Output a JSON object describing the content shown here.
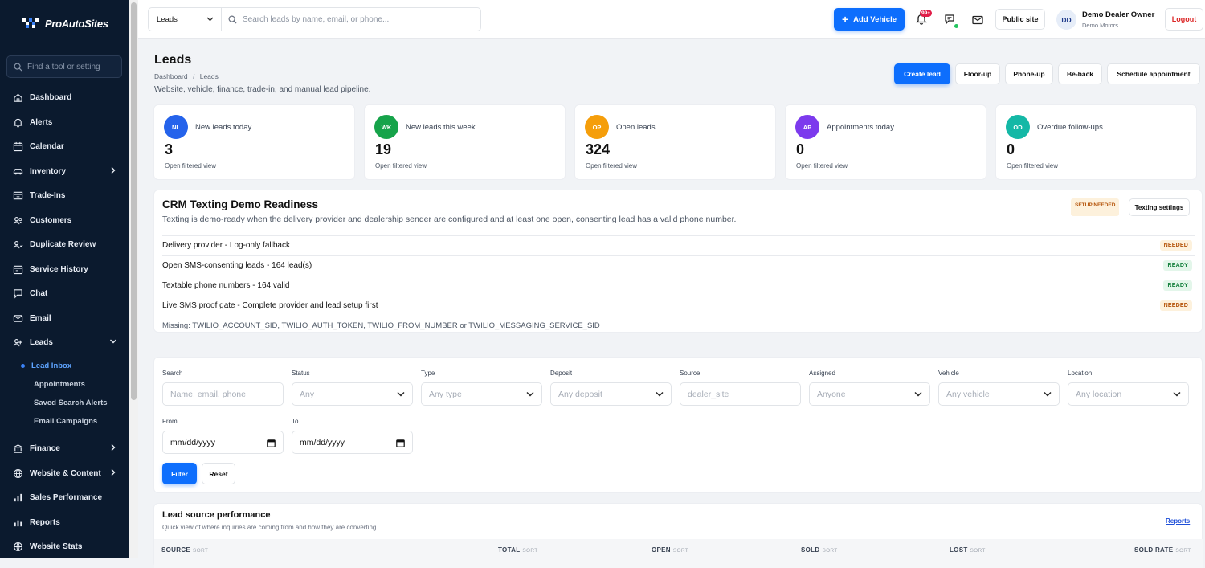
{
  "app": {
    "logo_text": "ProAutoSites"
  },
  "sidebar": {
    "search_placeholder": "Find a tool or setting",
    "items": [
      {
        "label": "Dashboard",
        "icon": "home-icon"
      },
      {
        "label": "Alerts",
        "icon": "bell-icon"
      },
      {
        "label": "Calendar",
        "icon": "calendar-icon"
      },
      {
        "label": "Inventory",
        "icon": "car-icon",
        "chevron": "right"
      },
      {
        "label": "Trade-Ins",
        "icon": "trade-icon"
      },
      {
        "label": "Customers",
        "icon": "users-icon"
      },
      {
        "label": "Duplicate Review",
        "icon": "duplicate-icon"
      },
      {
        "label": "Service History",
        "icon": "history-icon"
      },
      {
        "label": "Chat",
        "icon": "chat-icon"
      },
      {
        "label": "Email",
        "icon": "mail-icon"
      },
      {
        "label": "Leads",
        "icon": "leads-icon",
        "chevron": "down"
      }
    ],
    "sub_items": [
      {
        "label": "Lead Inbox",
        "active": true
      },
      {
        "label": "Appointments"
      },
      {
        "label": "Saved Search Alerts"
      },
      {
        "label": "Email Campaigns"
      }
    ],
    "items_after": [
      {
        "label": "Finance",
        "icon": "finance-icon",
        "chevron": "right"
      },
      {
        "label": "Website & Content",
        "icon": "globe-icon",
        "chevron": "right"
      },
      {
        "label": "Sales Performance",
        "icon": "chart-icon"
      },
      {
        "label": "Reports",
        "icon": "report-icon"
      },
      {
        "label": "Website Stats",
        "icon": "stats-icon"
      }
    ]
  },
  "topbar": {
    "scope_select": "Leads",
    "search_placeholder": "Search leads by name, email, or phone...",
    "add_vehicle": "Add Vehicle",
    "notif_count": "99+",
    "public_site": "Public site",
    "user_initials": "DD",
    "user_name": "Demo Dealer Owner",
    "user_org": "Demo Motors",
    "logout": "Logout"
  },
  "page": {
    "title": "Leads",
    "breadcrumb": [
      "Dashboard",
      "/",
      "Leads"
    ],
    "subtitle": "Website, vehicle, finance, trade-in, and manual lead pipeline.",
    "actions": [
      "Create lead",
      "Floor-up",
      "Phone-up",
      "Be-back",
      "Schedule appointment"
    ]
  },
  "stats": [
    {
      "abbr": "NL",
      "label": "New leads today",
      "value": "3",
      "link": "Open filtered view",
      "color": "#2563eb"
    },
    {
      "abbr": "WK",
      "label": "New leads this week",
      "value": "19",
      "link": "Open filtered view",
      "color": "#16a34a"
    },
    {
      "abbr": "OP",
      "label": "Open leads",
      "value": "324",
      "link": "Open filtered view",
      "color": "#f59e0b"
    },
    {
      "abbr": "AP",
      "label": "Appointments today",
      "value": "0",
      "link": "Open filtered view",
      "color": "#7c3aed"
    },
    {
      "abbr": "OD",
      "label": "Overdue follow-ups",
      "value": "0",
      "link": "Open filtered view",
      "color": "#14b8a6"
    }
  ],
  "crm": {
    "title": "CRM Texting Demo Readiness",
    "desc": "Texting is demo-ready when the delivery provider and dealership sender are configured and at least one open, consenting lead has a valid phone number.",
    "status_badge": "SETUP NEEDED",
    "settings_button": "Texting settings",
    "rows": [
      {
        "text": "Delivery provider - Log-only fallback",
        "status": "NEEDED"
      },
      {
        "text": "Open SMS-consenting leads - 164 lead(s)",
        "status": "READY"
      },
      {
        "text": "Textable phone numbers - 164 valid",
        "status": "READY"
      },
      {
        "text": "Live SMS proof gate - Complete provider and lead setup first",
        "status": "NEEDED"
      }
    ],
    "missing": "Missing: TWILIO_ACCOUNT_SID, TWILIO_AUTH_TOKEN, TWILIO_FROM_NUMBER or TWILIO_MESSAGING_SERVICE_SID"
  },
  "filters": {
    "fields": [
      {
        "label": "Search",
        "placeholder": "Name, email, phone",
        "dropdown": false
      },
      {
        "label": "Status",
        "placeholder": "Any",
        "dropdown": true
      },
      {
        "label": "Type",
        "placeholder": "Any type",
        "dropdown": true
      },
      {
        "label": "Deposit",
        "placeholder": "Any deposit",
        "dropdown": true
      },
      {
        "label": "Source",
        "placeholder": "dealer_site",
        "dropdown": false
      },
      {
        "label": "Assigned",
        "placeholder": "Anyone",
        "dropdown": true
      },
      {
        "label": "Vehicle",
        "placeholder": "Any vehicle",
        "dropdown": true
      },
      {
        "label": "Location",
        "placeholder": "Any location",
        "dropdown": true
      }
    ],
    "from_label": "From",
    "to_label": "To",
    "date_placeholder": "mm/dd/yyyy",
    "filter_button": "Filter",
    "reset_button": "Reset"
  },
  "source_perf": {
    "title": "Lead source performance",
    "desc": "Quick view of where inquiries are coming from and how they are converting.",
    "reports_link": "Reports",
    "columns": [
      "SOURCE",
      "TOTAL",
      "OPEN",
      "SOLD",
      "LOST",
      "SOLD RATE"
    ],
    "sort_label": "SORT"
  }
}
